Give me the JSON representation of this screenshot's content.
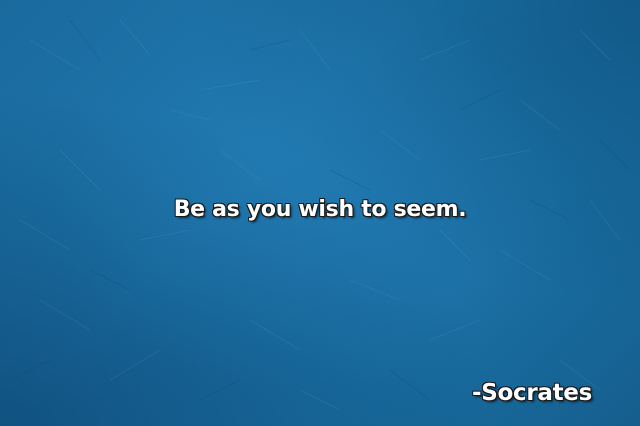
{
  "quote": {
    "text": "Be as you wish to seem.",
    "author": "-Socrates"
  },
  "colors": {
    "background": "#1e78ae",
    "text": "#ffffff",
    "text_outline": "#1a1a1a"
  }
}
